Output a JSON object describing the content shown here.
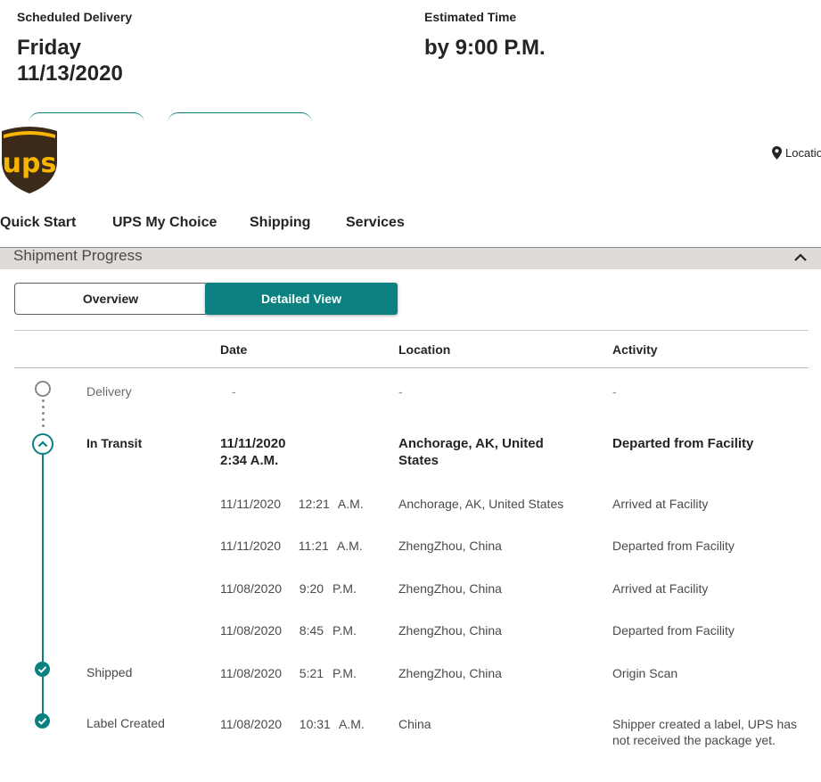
{
  "delivery": {
    "scheduled_label": "Scheduled Delivery",
    "day": "Friday",
    "date": "11/13/2020",
    "estimated_label": "Estimated Time",
    "time": "by 9:00 P.M."
  },
  "header": {
    "logo_text": "ups",
    "location_label": "Locatio"
  },
  "nav": {
    "items": [
      "Quick Start",
      "UPS My Choice",
      "Shipping",
      "Services"
    ]
  },
  "section": {
    "title": "Shipment Progress"
  },
  "tabs": {
    "overview": "Overview",
    "detailed": "Detailed View"
  },
  "table": {
    "headers": {
      "date": "Date",
      "location": "Location",
      "activity": "Activity"
    },
    "delivery_row": {
      "status": "Delivery",
      "date": "-",
      "location": "-",
      "activity": "-"
    },
    "transit_row": {
      "status": "In Transit",
      "date_line1": "11/11/2020",
      "date_line2": "2:34 A.M.",
      "location_line1": "Anchorage, AK, United",
      "location_line2": "States",
      "activity": "Departed from Facility"
    },
    "rows": [
      {
        "date": "11/11/2020  12:21 A.M.",
        "location": "Anchorage, AK, United States",
        "activity": "Arrived at Facility"
      },
      {
        "date": "11/11/2020  11:21 A.M.",
        "location": "ZhengZhou, China",
        "activity": "Departed from Facility"
      },
      {
        "date": "11/08/2020  9:20 P.M.",
        "location": "ZhengZhou, China",
        "activity": "Arrived at Facility"
      },
      {
        "date": "11/08/2020  8:45 P.M.",
        "location": "ZhengZhou, China",
        "activity": "Departed from Facility"
      }
    ],
    "shipped_row": {
      "status": "Shipped",
      "date": "11/08/2020  5:21 P.M.",
      "location": "ZhengZhou, China",
      "activity": "Origin Scan"
    },
    "label_row": {
      "status": "Label Created",
      "date": "11/08/2020  10:31 A.M.",
      "location": "China",
      "activity_line1": "Shipper created a label, UPS has",
      "activity_line2": "not received the package yet."
    }
  },
  "colors": {
    "teal": "#0a8080",
    "ups_brown": "#3b2a1a",
    "ups_gold": "#f7b500"
  }
}
